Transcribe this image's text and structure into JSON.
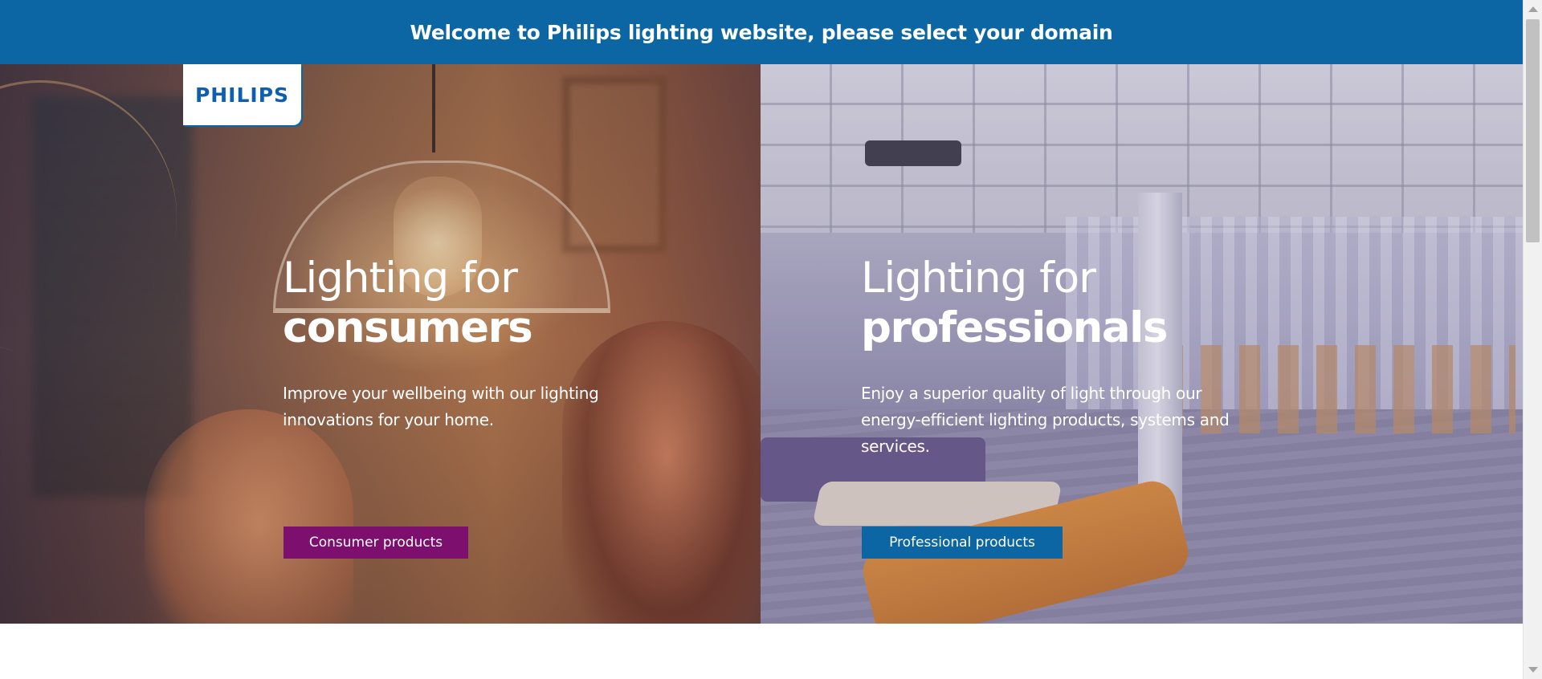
{
  "banner": {
    "text": "Welcome to Philips lighting website, please select your domain"
  },
  "logo": {
    "text": "PHILIPS"
  },
  "consumer": {
    "heading_light": "Lighting for",
    "heading_bold": "consumers",
    "description": "Improve your wellbeing with our lighting innovations for your home.",
    "button_label": "Consumer products"
  },
  "professional": {
    "heading_light": "Lighting for",
    "heading_bold": "professionals",
    "description": "Enjoy a superior quality of light through our energy-efficient lighting products, systems and services.",
    "button_label": "Professional products"
  },
  "colors": {
    "brand_blue": "#0b66a3",
    "consumer_button": "#7d0f6e",
    "professional_button": "#0b66a3"
  }
}
